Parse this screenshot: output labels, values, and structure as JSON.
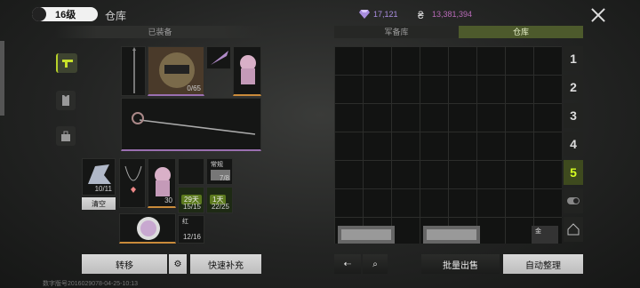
{
  "header": {
    "level": "16级",
    "title": "仓库",
    "gems": "17,121",
    "coins": "13,381,394"
  },
  "tabs": {
    "equipped": "已装备",
    "armory": "军备库",
    "warehouse": "仓库"
  },
  "equipped": {
    "helmet_count": "0/65"
  },
  "backpack": {
    "dragon_count": "10/11",
    "clear_label": "清空",
    "box_tag": "常规",
    "box_count": "7/8",
    "cat_count": "30",
    "day1": "29天",
    "day1_count": "15/15",
    "day2": "1天",
    "day2_count": "22/25",
    "red_tag": "红",
    "red_count": "12/16"
  },
  "pages": [
    "1",
    "2",
    "3",
    "4",
    "5"
  ],
  "gold_tag": "金",
  "buttons": {
    "transfer": "转移",
    "quick_refill": "快速补充",
    "batch_sell": "批量出售",
    "auto_sort": "自动整理"
  },
  "footer_text": "数字版号2016029078-04-25-10:13",
  "colors": {
    "active_green": "#d6ff22",
    "gem": "#a98ee0",
    "coin": "#b86ab8"
  }
}
